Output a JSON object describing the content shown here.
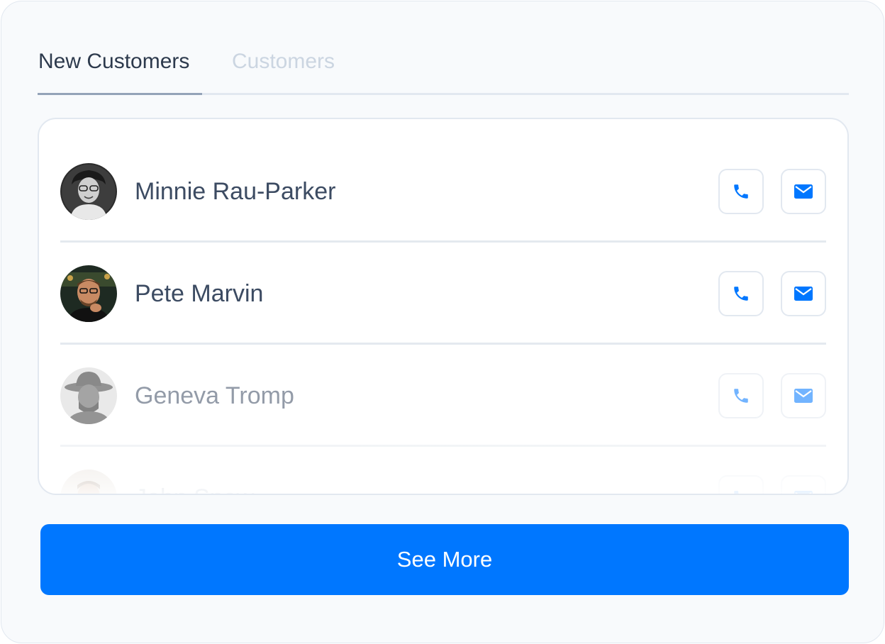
{
  "tabs": [
    {
      "label": "New Customers",
      "active": true
    },
    {
      "label": "Customers",
      "active": false
    }
  ],
  "customers": [
    {
      "name": "Minnie Rau-Parker",
      "avatar": "avatar-photo"
    },
    {
      "name": "Pete Marvin",
      "avatar": "avatar-photo"
    },
    {
      "name": "Geneva Tromp",
      "avatar": "avatar-photo"
    },
    {
      "name": "John Snow",
      "avatar": "avatar-photo"
    }
  ],
  "actions": {
    "phone_icon": "phone-icon",
    "mail_icon": "mail-icon"
  },
  "see_more_label": "See More",
  "colors": {
    "accent": "#0077ff",
    "text": "#3c4b62",
    "border": "#e2e8f0",
    "muted": "#cbd5e1"
  }
}
